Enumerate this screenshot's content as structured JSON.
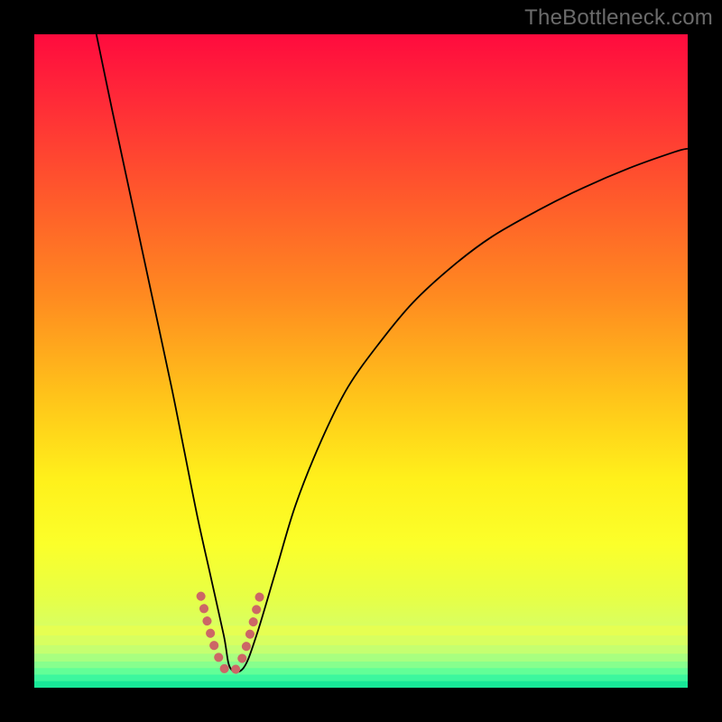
{
  "watermark": "TheBottleneck.com",
  "chart_data": {
    "type": "line",
    "title": "",
    "xlabel": "",
    "ylabel": "",
    "xlim": [
      0,
      100
    ],
    "ylim": [
      0,
      100
    ],
    "series": [
      {
        "name": "bottleneck-curve",
        "color": "#000000",
        "stroke_width": 1.8,
        "x": [
          9.5,
          12,
          15,
          18,
          21,
          23,
          25,
          27,
          29,
          30,
          32,
          34,
          37,
          40,
          44,
          48,
          53,
          58,
          64,
          70,
          77,
          84,
          91,
          98,
          100
        ],
        "y": [
          100,
          88,
          74,
          60,
          46,
          36,
          26,
          17,
          8,
          3,
          3,
          8,
          18,
          28,
          38,
          46,
          53,
          59,
          64.5,
          69,
          73,
          76.5,
          79.5,
          82,
          82.5
        ]
      },
      {
        "name": "valley-emphasis",
        "color": "#cc6666",
        "stroke_width": 10,
        "linecap": "round",
        "dash": "0.1 14",
        "x": [
          25.5,
          26.5,
          27.5,
          28.5,
          29.2,
          30,
          30.8,
          31.6,
          32.5,
          33.5,
          34.5
        ],
        "y": [
          14,
          10,
          6.5,
          4,
          2.8,
          2.5,
          2.8,
          4,
          6.5,
          10,
          14
        ]
      }
    ],
    "gradient_stops": [
      {
        "offset": 0.0,
        "color": "#ff0b3e"
      },
      {
        "offset": 0.1,
        "color": "#ff2a38"
      },
      {
        "offset": 0.25,
        "color": "#ff5a2b"
      },
      {
        "offset": 0.4,
        "color": "#ff8a20"
      },
      {
        "offset": 0.55,
        "color": "#ffc21a"
      },
      {
        "offset": 0.68,
        "color": "#fff01b"
      },
      {
        "offset": 0.78,
        "color": "#fbff2a"
      },
      {
        "offset": 0.86,
        "color": "#e7ff45"
      },
      {
        "offset": 0.905,
        "color": "#d9ff60"
      },
      {
        "offset": 0.93,
        "color": "#beff78"
      },
      {
        "offset": 0.955,
        "color": "#8dff8d"
      },
      {
        "offset": 0.975,
        "color": "#4dffa0"
      },
      {
        "offset": 0.99,
        "color": "#17f8a2"
      },
      {
        "offset": 1.0,
        "color": "#0adf88"
      }
    ],
    "bands": [
      {
        "y": 0.905,
        "color": "#e6ff52"
      },
      {
        "y": 0.92,
        "color": "#d8ff60"
      },
      {
        "y": 0.935,
        "color": "#c5ff70"
      },
      {
        "y": 0.948,
        "color": "#a8ff80"
      },
      {
        "y": 0.96,
        "color": "#87ff8d"
      },
      {
        "y": 0.97,
        "color": "#62ff97"
      },
      {
        "y": 0.98,
        "color": "#3cf79e"
      },
      {
        "y": 0.99,
        "color": "#18e998"
      }
    ]
  }
}
